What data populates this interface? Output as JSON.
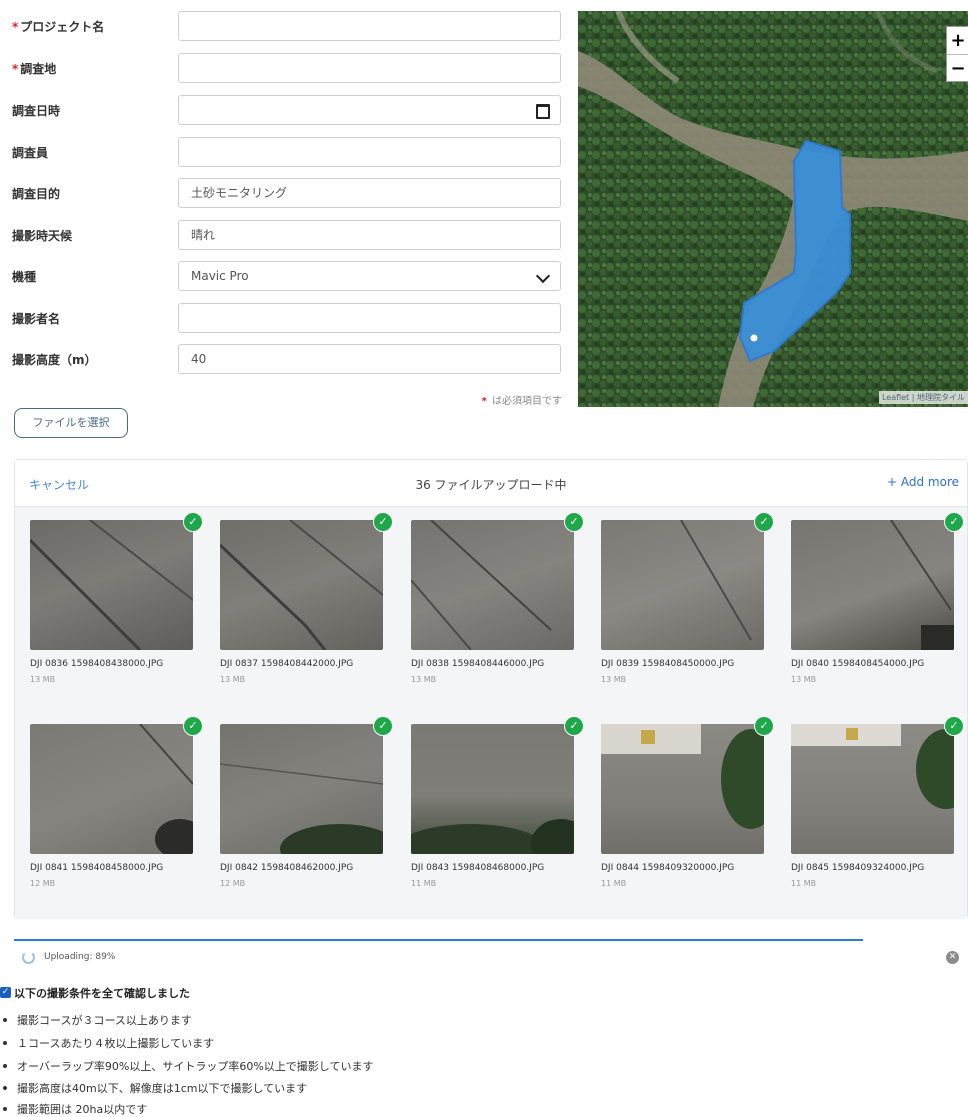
{
  "form": {
    "project_name": {
      "label": "プロジェクト名",
      "required": true,
      "value": ""
    },
    "survey_site": {
      "label": "調査地",
      "required": true,
      "value": ""
    },
    "survey_datetime": {
      "label": "調査日時",
      "value": ""
    },
    "surveyor": {
      "label": "調査員",
      "value": ""
    },
    "survey_purpose": {
      "label": "調査目的",
      "value": "土砂モニタリング"
    },
    "weather": {
      "label": "撮影時天候",
      "value": "晴れ"
    },
    "aircraft_model": {
      "label": "機種",
      "value": "Mavic Pro"
    },
    "photographer": {
      "label": "撮影者名",
      "value": ""
    },
    "altitude": {
      "label": "撮影高度（m）",
      "value": "40"
    },
    "required_mark": "*",
    "required_note": "は必須項目です",
    "file_select_label": "ファイルを選択"
  },
  "map": {
    "zoom_in": "+",
    "zoom_out": "−",
    "attribution": "Leaflet | 地理院タイル"
  },
  "uploader": {
    "cancel_label": "キャンセル",
    "title": "36 ファイルアップロード中",
    "add_more_label": "+ Add more",
    "files": [
      {
        "name": "DJI 0836 1598408438000.JPG",
        "size": "13 MB"
      },
      {
        "name": "DJI 0837 1598408442000.JPG",
        "size": "13 MB"
      },
      {
        "name": "DJI 0838 1598408446000.JPG",
        "size": "13 MB"
      },
      {
        "name": "DJI 0839 1598408450000.JPG",
        "size": "13 MB"
      },
      {
        "name": "DJI 0840 1598408454000.JPG",
        "size": "13 MB"
      },
      {
        "name": "DJI 0841 1598408458000.JPG",
        "size": "12 MB"
      },
      {
        "name": "DJI 0842 1598408462000.JPG",
        "size": "12 MB"
      },
      {
        "name": "DJI 0843 1598408468000.JPG",
        "size": "11 MB"
      },
      {
        "name": "DJI 0844 1598409320000.JPG",
        "size": "11 MB"
      },
      {
        "name": "DJI 0845 1598409324000.JPG",
        "size": "11 MB"
      }
    ],
    "progress_text": "Uploading: 89%",
    "progress_fraction": 0.89
  },
  "conditions": {
    "checkbox_label": "以下の撮影条件を全て確認しました",
    "checked": true,
    "items": [
      "撮影コースが３コース以上あります",
      "１コースあたり４枚以上撮影しています",
      "オーバーラップ率90%以上、サイトラップ率60%以上で撮影しています",
      "撮影高度は40m以下、解像度は1cm以下で撮影しています",
      "撮影範囲は 20ha以内です"
    ]
  },
  "colors": {
    "accent": "#2f7ad6",
    "success": "#1fa84a",
    "required": "#e02020",
    "flight_area": "#3b8fd8"
  }
}
